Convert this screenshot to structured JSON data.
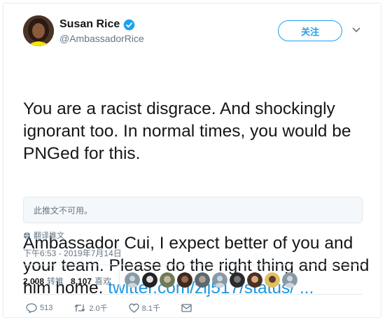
{
  "user": {
    "name": "Susan Rice",
    "handle": "@AmbassadorRice"
  },
  "follow_label": "关注",
  "tweet": {
    "paragraph1": "You are a racist disgrace. And shockingly\nignorant too. In normal times, you would be\nPNGed for this.",
    "paragraph2_text": "Ambassador Cui, I expect better of you and\nyour team. Please do the right thing and send\nhim home. ",
    "paragraph2_link": "twitter.com/zlj517/status/ ..."
  },
  "quoted_unavailable": "此推文不可用。",
  "translate_label": "翻译推文",
  "timestamp": "下午6:53 - 2019年7月14日",
  "stats": {
    "retweets_count": "2,008",
    "retweets_label": "转推",
    "likes_count": "8,107",
    "likes_label": "喜欢"
  },
  "likers": [
    {
      "icon": "avatar"
    },
    {
      "icon": "avatar"
    },
    {
      "icon": "avatar"
    },
    {
      "icon": "avatar"
    },
    {
      "icon": "avatar"
    },
    {
      "icon": "avatar"
    },
    {
      "icon": "avatar"
    },
    {
      "icon": "avatar"
    },
    {
      "icon": "avatar"
    },
    {
      "icon": "avatar"
    }
  ],
  "actions": {
    "reply_count": "513",
    "retweet_count": "2.0千",
    "like_count": "8.1千"
  },
  "colors": {
    "accent": "#1da1f2",
    "link": "#1b95e0",
    "text": "#14171a",
    "muted": "#657786"
  }
}
